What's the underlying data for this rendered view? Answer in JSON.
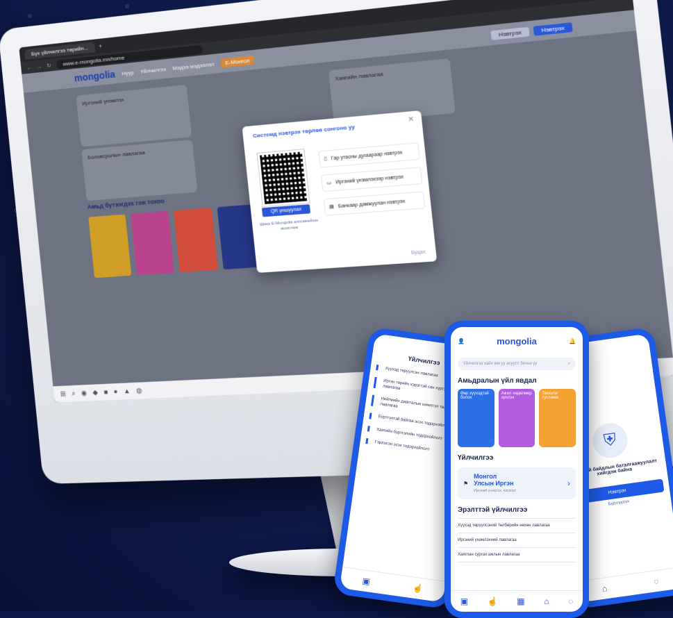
{
  "browser": {
    "tab_title": "Бүх үйлчилгээ төрийн...",
    "url": "www.e-mongolia.mn/home"
  },
  "site": {
    "logo": "mongolia",
    "nav": [
      "Нүүр",
      "Үйлчилгээ",
      "Мэдээ мэдээлэл"
    ],
    "nav_highlight": "Е-Монгол",
    "login_ghost": "Нэвтрэх",
    "login_primary": "Нэвтрэх",
    "card1_title": "Иргэний үнэмлэх",
    "card2_title": "Хаягийн лавлагаа",
    "card3_title": "Боловсролын лавлагаа",
    "section_title": "Амьд бүтээгдэх гэж тохоо"
  },
  "modal": {
    "title": "Системд нэвтрэх төрлөө сонгоно уу",
    "qr_button": "QR уншуулах",
    "qr_caption": "Шинэ E-Mongolia аппликейшн ашиглаж",
    "options": [
      "Гар утасны дугаараар нэвтрэх",
      "Иргэний үнэмлэхээр нэвтрэх",
      "Банкаар дамжуулан нэвтрэх"
    ],
    "footer": "Буцах"
  },
  "phone_center": {
    "logo": "mongolia",
    "search_placeholder": "Үйлчилгээ хайх юм уу асуулт бичнэ үү",
    "section1": "Амьдралын үйл явдал",
    "cards": [
      "Өөр хүүхэдтэй болох",
      "Ажил хөдөлмөр эрхлэх",
      "Эмнэлэг тусламж"
    ],
    "section2": "Үйлчилгээ",
    "banner_line1": "Монгол",
    "banner_line2": "Улсын Иргэн",
    "banner_sub": "Иргэний үнэмлэх, паспорт",
    "section3": "Эрэлттэй үйлчилгээ",
    "list": [
      "Хүүхэд төрүүлсэний төлбөрийн нөхөн лавлагаа",
      "Иргэний үнэмлэхний лавлагаа",
      "Хаяглан сургах ажлын лавлагаа"
    ]
  },
  "phone_left": {
    "title": "Үйлчилгээ",
    "items": [
      "Хүүхэд төрүүлсэн лавлагаа",
      "Иргэн төрийн хэрэгтэй сан хүртэгчдийн лавлагаа",
      "Нийгмийн даатгалын шимтгэл төлөлтийн лавлагаа",
      "Бүртгэлтэй байгаа эсэх тодорхойлолт",
      "Хаягийн бүртгэлийн тодорхойлолт",
      "Гэрлэсэн эсэх тодорхойлолт"
    ]
  },
  "phone_right": {
    "text": "Аюулгүй байдлын баталгаажуулалт хийгдэж байна",
    "button": "Нэвтрэх",
    "link": "Бүртгүүлэх"
  },
  "icons": {
    "notification": "bell-icon",
    "profile": "user-icon",
    "qr": "qr-icon"
  },
  "colors": {
    "brand": "#1e5ae8",
    "background": "#0c1a4a",
    "accent": "#d7883a"
  }
}
